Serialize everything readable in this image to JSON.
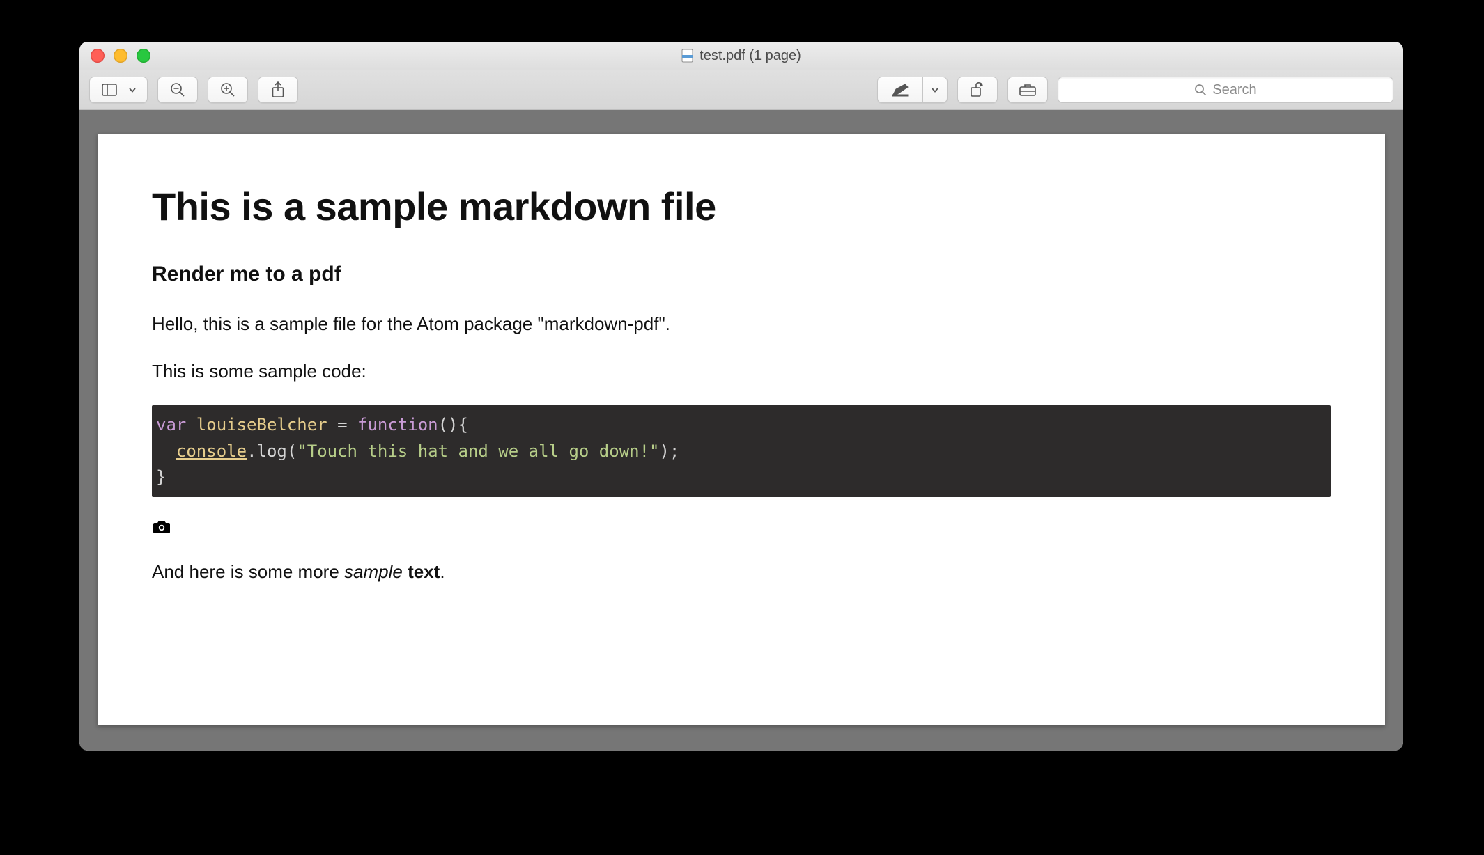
{
  "window": {
    "file_icon": "pdf-file-icon",
    "title": "test.pdf (1 page)"
  },
  "toolbar": {
    "sidebar_button": "sidebar",
    "zoom_out": "zoom-out",
    "zoom_in": "zoom-in",
    "share": "share",
    "annotate": "annotate",
    "annotate_menu": "annotate-menu",
    "rotate": "rotate",
    "markup": "markup-toolbox",
    "search_placeholder": "Search"
  },
  "document": {
    "h1": "This is a sample markdown file",
    "h2": "Render me to a pdf",
    "p1": "Hello, this is a sample file for the Atom package \"markdown-pdf\".",
    "p2": "This is some sample code:",
    "code": {
      "line1_kw": "var",
      "line1_name": " louiseBelcher ",
      "line1_eq": "= ",
      "line1_func": "function",
      "line1_rest": "(){",
      "line2_indent": "  ",
      "line2_obj": "console",
      "line2_dot": ".log(",
      "line2_str": "\"Touch this hat and we all go down!\"",
      "line2_end": ");",
      "line3": "}"
    },
    "image_alt": "camera-icon",
    "p3_a": "And here is some more ",
    "p3_italic": "sample ",
    "p3_bold": "text",
    "p3_end": "."
  }
}
